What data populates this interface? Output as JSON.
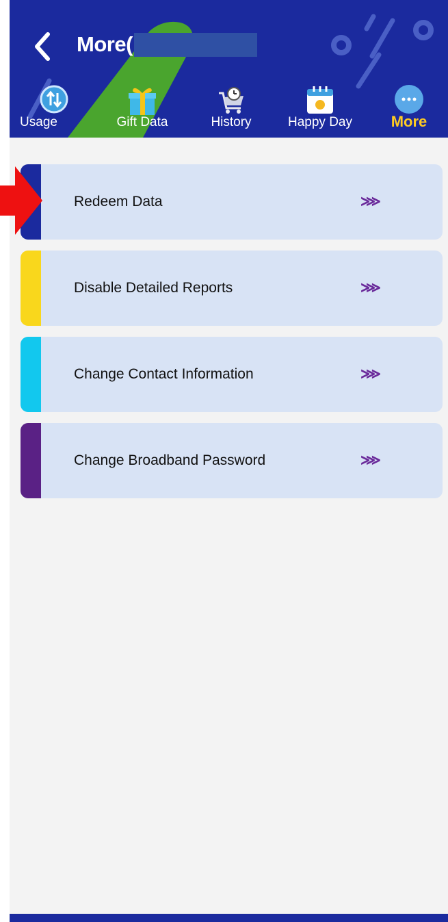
{
  "header": {
    "title": "More(",
    "back_icon": "chevron-left-icon",
    "colors": {
      "background": "#1b2a9e",
      "accent_green": "#4aa52e",
      "active_tab": "#ffcc22"
    }
  },
  "tabs": [
    {
      "label": "Usage",
      "icon": "up-down-arrows-icon",
      "active": false
    },
    {
      "label": "Gift Data",
      "icon": "gift-icon",
      "active": false
    },
    {
      "label": "History",
      "icon": "cart-clock-icon",
      "active": false
    },
    {
      "label": "Happy Day",
      "icon": "calendar-smile-icon",
      "active": false
    },
    {
      "label": "More",
      "icon": "more-dots-icon",
      "active": true
    }
  ],
  "menu": {
    "items": [
      {
        "label": "Redeem Data",
        "chevron": "⋙",
        "stripe_color": "#1b2a9e"
      },
      {
        "label": "Disable Detailed Reports",
        "chevron": "⋙",
        "stripe_color": "#f9d71c"
      },
      {
        "label": "Change Contact Information",
        "chevron": "⋙",
        "stripe_color": "#12c8ee"
      },
      {
        "label": "Change Broadband Password",
        "chevron": "⋙",
        "stripe_color": "#5a2185"
      }
    ],
    "item_background": "#d8e3f5",
    "chevron_color": "#6a2a9a"
  }
}
